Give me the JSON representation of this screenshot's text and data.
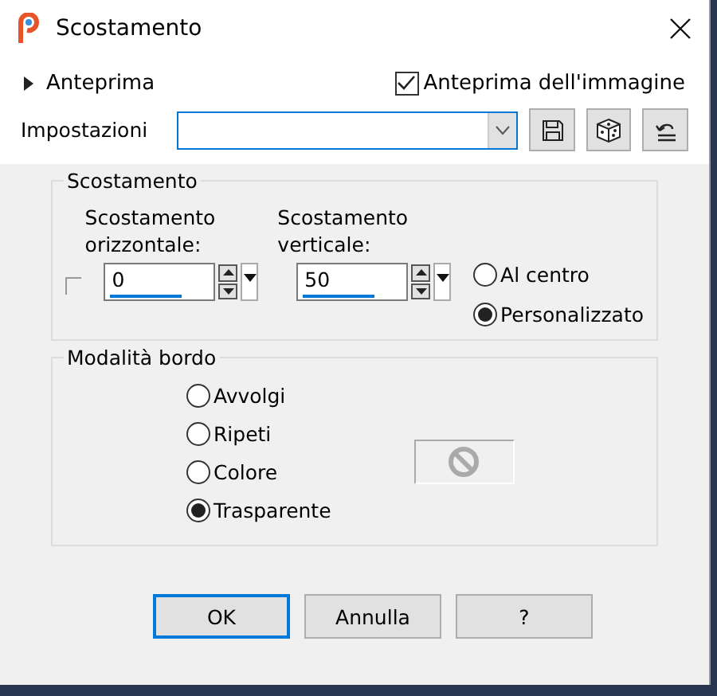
{
  "window": {
    "title": "Scostamento"
  },
  "preview_toggle": {
    "label": "Anteprima",
    "expanded": false
  },
  "image_preview": {
    "label": "Anteprima dell'immagine",
    "checked": true
  },
  "settings": {
    "label": "Impostazioni"
  },
  "offset_group": {
    "title": "Scostamento",
    "link_checked": false,
    "fields": [
      {
        "label": "Scostamento orizzontale:",
        "value": "0"
      },
      {
        "label": "Scostamento verticale:",
        "value": "50"
      }
    ],
    "position": [
      {
        "label": "Al centro",
        "selected": false
      },
      {
        "label": "Personalizzato",
        "selected": true
      }
    ]
  },
  "edge_group": {
    "title": "Modalità bordo",
    "options": [
      {
        "label": "Avvolgi",
        "selected": false
      },
      {
        "label": "Ripeti",
        "selected": false
      },
      {
        "label": "Colore",
        "selected": false
      },
      {
        "label": "Trasparente",
        "selected": true
      }
    ]
  },
  "buttons": [
    {
      "label": "OK",
      "kind": "default"
    },
    {
      "label": "Annulla",
      "kind": "normal"
    },
    {
      "label": "?",
      "kind": "normal"
    }
  ]
}
